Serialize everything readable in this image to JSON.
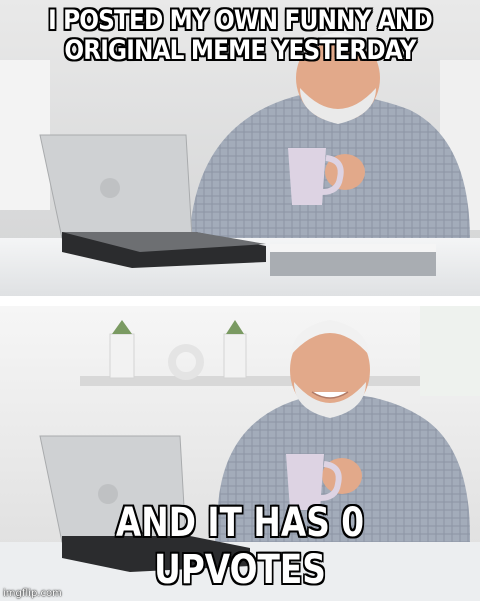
{
  "meme": {
    "top_caption": "I POSTED MY OWN FUNNY AND ORIGINAL MEME YESTERDAY",
    "bottom_caption": "AND IT HAS 0 UPVOTES",
    "watermark": "imgflip.com"
  },
  "colors": {
    "wall": "#dcdcdc",
    "desk": "#eceef0",
    "shirt": "#9ea7b5",
    "skin": "#e2a98a",
    "hair": "#ececec",
    "laptop": "#c9cbcd",
    "mug": "#d9d0df"
  }
}
